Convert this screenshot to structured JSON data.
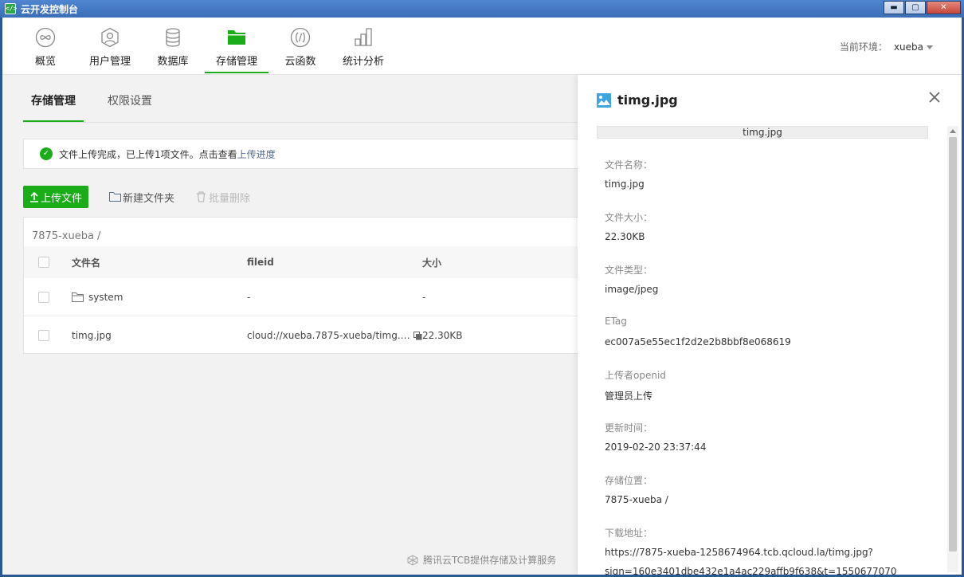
{
  "window": {
    "title": "云开发控制台",
    "controls": {
      "minimize": "▬",
      "maximize": "▢",
      "close": "✕"
    }
  },
  "topnav": {
    "items": [
      {
        "label": "概览",
        "icon": "infinity-icon"
      },
      {
        "label": "用户管理",
        "icon": "user-icon"
      },
      {
        "label": "数据库",
        "icon": "database-icon"
      },
      {
        "label": "存储管理",
        "icon": "folder-icon",
        "active": true
      },
      {
        "label": "云函数",
        "icon": "function-icon"
      },
      {
        "label": "统计分析",
        "icon": "bar-chart-icon"
      }
    ],
    "env_label": "当前环境：",
    "env_value": "xueba"
  },
  "subtabs": {
    "storage": "存储管理",
    "permissions": "权限设置"
  },
  "notice": {
    "text": "文件上传完成，已上传1项文件。点击查看",
    "link": "上传进度"
  },
  "toolbar": {
    "upload": "上传文件",
    "new_folder": "新建文件夹",
    "batch_delete": "批量删除"
  },
  "file_browser": {
    "breadcrumb": "7875-xueba  /",
    "columns": [
      "文件名",
      "fileid",
      "大小"
    ],
    "rows": [
      {
        "name": "system",
        "fileid": "-",
        "size": "-",
        "is_folder": true
      },
      {
        "name": "timg.jpg",
        "fileid": "cloud://xueba.7875-xueba/timg.…",
        "size": "22.30KB",
        "is_folder": false
      }
    ]
  },
  "footer": {
    "text": "腾讯云TCB提供存储及计算服务"
  },
  "detail": {
    "title": "timg.jpg",
    "preview_caption": "timg.jpg",
    "fields": [
      {
        "label": "文件名称：",
        "value": "timg.jpg"
      },
      {
        "label": "文件大小：",
        "value": "22.30KB"
      },
      {
        "label": "文件类型：",
        "value": "image/jpeg"
      },
      {
        "label": "ETag",
        "value": "ec007a5e55ec1f2d2e2b8bbf8e068619"
      },
      {
        "label": "上传者openid",
        "value": "管理员上传"
      },
      {
        "label": "更新时间：",
        "value": "2019-02-20 23:37:44"
      },
      {
        "label": "存储位置：",
        "value": "7875-xueba /"
      },
      {
        "label": "下载地址：",
        "value": "https://7875-xueba-1258674964.tcb.qcloud.la/timg.jpg?"
      },
      {
        "label": "",
        "value": "sign=160e3401dbe432e1a4ac229affb9f638&t=1550677070"
      }
    ]
  },
  "colors": {
    "accent": "#1aad19",
    "link": "#576b95",
    "titlebar": "#3b6fb8"
  }
}
